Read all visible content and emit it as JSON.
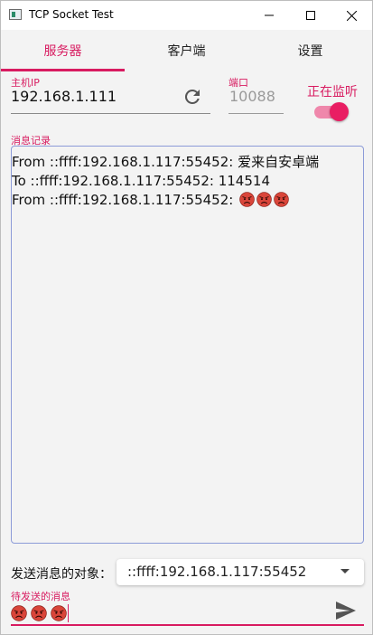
{
  "window": {
    "title": "TCP Socket Test"
  },
  "tabs": [
    {
      "label": "服务器",
      "active": true
    },
    {
      "label": "客户端",
      "active": false
    },
    {
      "label": "设置",
      "active": false
    }
  ],
  "server": {
    "host_label": "主机IP",
    "host_value": "192.168.1.111",
    "port_label": "端口",
    "port_placeholder": "10088",
    "listen_label": "正在监听",
    "listening": true
  },
  "log": {
    "label": "消息记录",
    "lines": [
      {
        "text": "From ::ffff:192.168.1.117:55452: 爱来自安卓端",
        "emoji_count": 0
      },
      {
        "text": "To ::ffff:192.168.1.117:55452: 114514",
        "emoji_count": 0
      },
      {
        "text": "From ::ffff:192.168.1.117:55452: ",
        "emoji_count": 3
      }
    ]
  },
  "send": {
    "target_label": "发送消息的对象：",
    "target_value": "::ffff:192.168.1.117:55452",
    "message_label": "待发送的消息",
    "message_emoji_count": 3
  },
  "icons": {
    "refresh": "refresh-icon",
    "send": "send-icon",
    "emoji": "pouting-face-emoji"
  },
  "colors": {
    "accent": "#d81b60",
    "switch_thumb": "#e91e63",
    "switch_track": "#ef87ab",
    "log_border": "#8c9bd8"
  }
}
